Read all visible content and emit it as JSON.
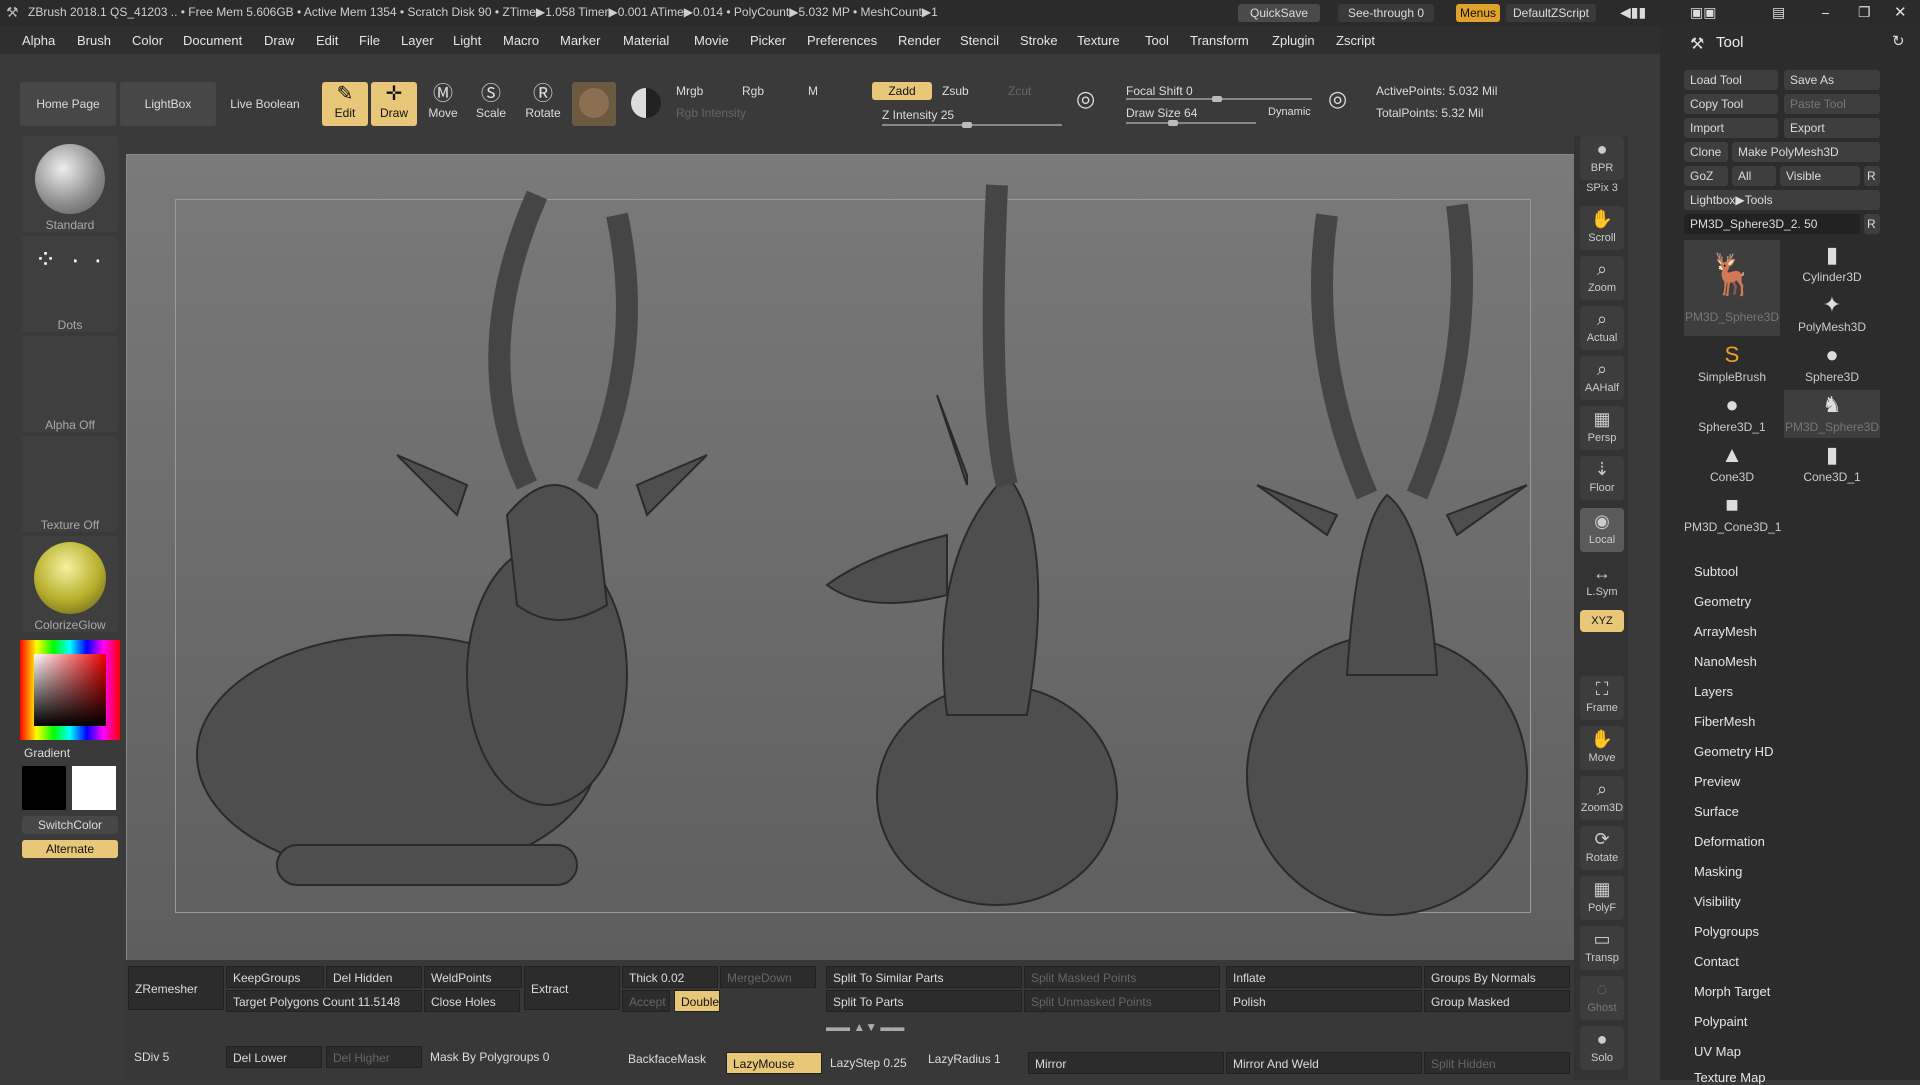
{
  "titlebar": {
    "info": "ZBrush 2018.1   QS_41203  .. • Free Mem 5.606GB • Active Mem 1354 • Scratch Disk 90 • ZTime▶1.058 Timer▶0.001 ATime▶0.014 • PolyCount▶5.032 MP • MeshCount▶1",
    "quicksave": "QuickSave",
    "see_through": "See-through  0",
    "menus": "Menus",
    "script": "DefaultZScript"
  },
  "menubar": [
    "Alpha",
    "Brush",
    "Color",
    "Document",
    "Draw",
    "Edit",
    "File",
    "Layer",
    "Light",
    "Macro",
    "Marker",
    "Material",
    "Movie",
    "Picker",
    "Preferences",
    "Render",
    "Stencil",
    "Stroke",
    "Texture",
    "Tool",
    "Transform",
    "Zplugin",
    "Zscript"
  ],
  "toolbar": {
    "home_page": "Home Page",
    "lightbox": "LightBox",
    "live_boolean": "Live Boolean",
    "edit": "Edit",
    "draw": "Draw",
    "move": "Move",
    "scale": "Scale",
    "rotate": "Rotate",
    "mrgb": "Mrgb",
    "rgb": "Rgb",
    "m": "M",
    "zadd": "Zadd",
    "zsub": "Zsub",
    "zcut": "Zcut",
    "rgb_intensity": "Rgb Intensity",
    "z_intensity": "Z Intensity 25",
    "focal_shift": "Focal Shift 0",
    "draw_size": "Draw Size 64",
    "dynamic": "Dynamic",
    "active_points": "ActivePoints: 5.032 Mil",
    "total_points": "TotalPoints: 5.32 Mil"
  },
  "leftshelf": {
    "standard": "Standard",
    "dots": "Dots",
    "alpha_off": "Alpha Off",
    "texture_off": "Texture Off",
    "colorize_glow": "ColorizeGlow",
    "gradient": "Gradient",
    "switch_color": "SwitchColor",
    "alternate": "Alternate"
  },
  "rshelf": [
    "BPR",
    "SPix 3",
    "Scroll",
    "Zoom",
    "Actual",
    "AAHalf",
    "Persp",
    "Floor",
    "Local",
    "L.Sym",
    "XYZ",
    "Frame",
    "Move",
    "Zoom3D",
    "Rotate",
    "PolyF",
    "Transp",
    "Ghost",
    "Solo"
  ],
  "toolpanel": {
    "title": "Tool",
    "load_tool": "Load Tool",
    "save_as": "Save As",
    "copy_tool": "Copy Tool",
    "paste_tool": "Paste Tool",
    "import": "Import",
    "export": "Export",
    "clone": "Clone",
    "make_polymesh": "Make PolyMesh3D",
    "goz": "GoZ",
    "all": "All",
    "visible": "Visible",
    "r": "R",
    "lightbox_tools": "Lightbox▶Tools",
    "current_tool": "PM3D_Sphere3D_2. 50",
    "tools": [
      "PM3D_Sphere3D",
      "Cylinder3D",
      "PolyMesh3D",
      "SimpleBrush",
      "Sphere3D",
      "Sphere3D_1",
      "PM3D_Sphere3D",
      "Cone3D",
      "Cone3D_1",
      "PM3D_Cone3D_1"
    ],
    "submenus": [
      "Subtool",
      "Geometry",
      "ArrayMesh",
      "NanoMesh",
      "Layers",
      "FiberMesh",
      "Geometry HD",
      "Preview",
      "Surface",
      "Deformation",
      "Masking",
      "Visibility",
      "Polygroups",
      "Contact",
      "Morph Target",
      "Polypaint",
      "UV Map",
      "Texture Map"
    ]
  },
  "bottom": {
    "zremesher": "ZRemesher",
    "keep_groups": "KeepGroups",
    "del_hidden": "Del Hidden",
    "weld_points": "WeldPoints",
    "extract": "Extract",
    "thick": "Thick 0.02",
    "merge_down": "MergeDown",
    "split_similar": "Split To Similar Parts",
    "split_masked": "Split Masked Points",
    "inflate": "Inflate",
    "groups_by_normals": "Groups By Normals",
    "target_polygons": "Target Polygons Count 11.5148",
    "close_holes": "Close Holes",
    "accept": "Accept",
    "double": "Double",
    "split_to_parts": "Split To Parts",
    "split_unmasked": "Split Unmasked Points",
    "polish": "Polish",
    "group_masked": "Group Masked",
    "sdiv": "SDiv 5",
    "del_lower": "Del Lower",
    "del_higher": "Del Higher",
    "mask_by_polygroups": "Mask By Polygroups 0",
    "backface_mask": "BackfaceMask",
    "lazymouse": "LazyMouse",
    "lazystep": "LazyStep 0.25",
    "lazyradius": "LazyRadius 1",
    "mirror": "Mirror",
    "mirror_and_weld": "Mirror And Weld",
    "split_hidden": "Split Hidden"
  }
}
